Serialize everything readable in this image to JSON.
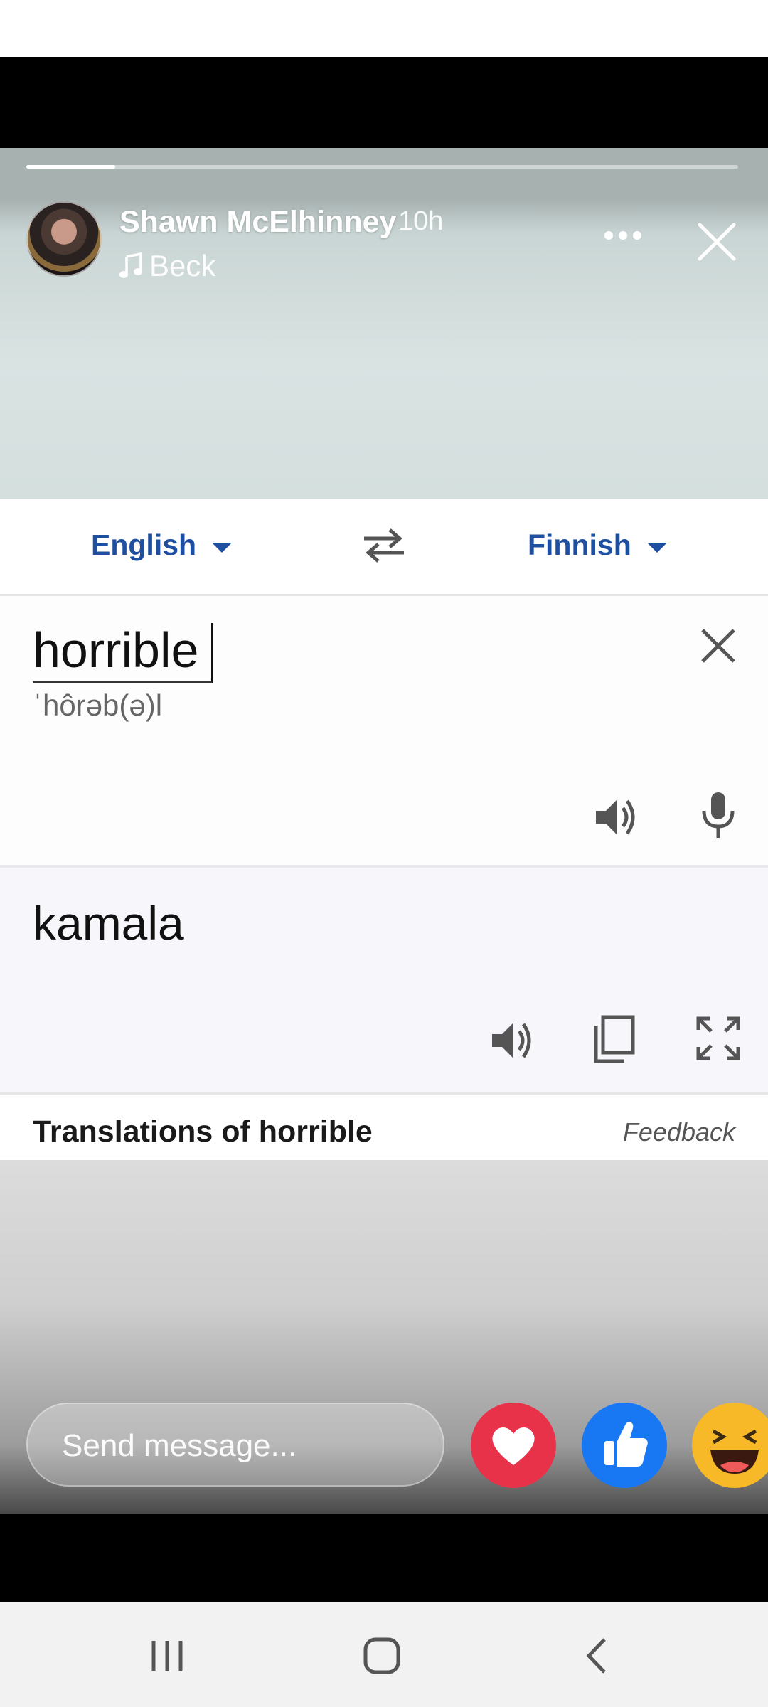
{
  "story": {
    "author": "Shawn McElhinney",
    "time": "10h",
    "music": "Beck",
    "progress": 0.125
  },
  "translate": {
    "source_lang": "English",
    "target_lang": "Finnish",
    "source_text": "horrible",
    "phonetic": "ˈhôrəb(ə)l",
    "target_text": "kamala",
    "translations_title": "Translations of horrible",
    "feedback": "Feedback"
  },
  "reply": {
    "placeholder": "Send message..."
  },
  "reactions": [
    "love",
    "like",
    "haha"
  ],
  "icons": {
    "more": "more-horizontal-icon",
    "close": "close-icon",
    "music": "music-note-icon"
  },
  "colors": {
    "translate_blue": "#1f4fa0",
    "love_red": "#e8324a",
    "like_blue": "#1877f2",
    "haha_yellow": "#f7b928"
  }
}
